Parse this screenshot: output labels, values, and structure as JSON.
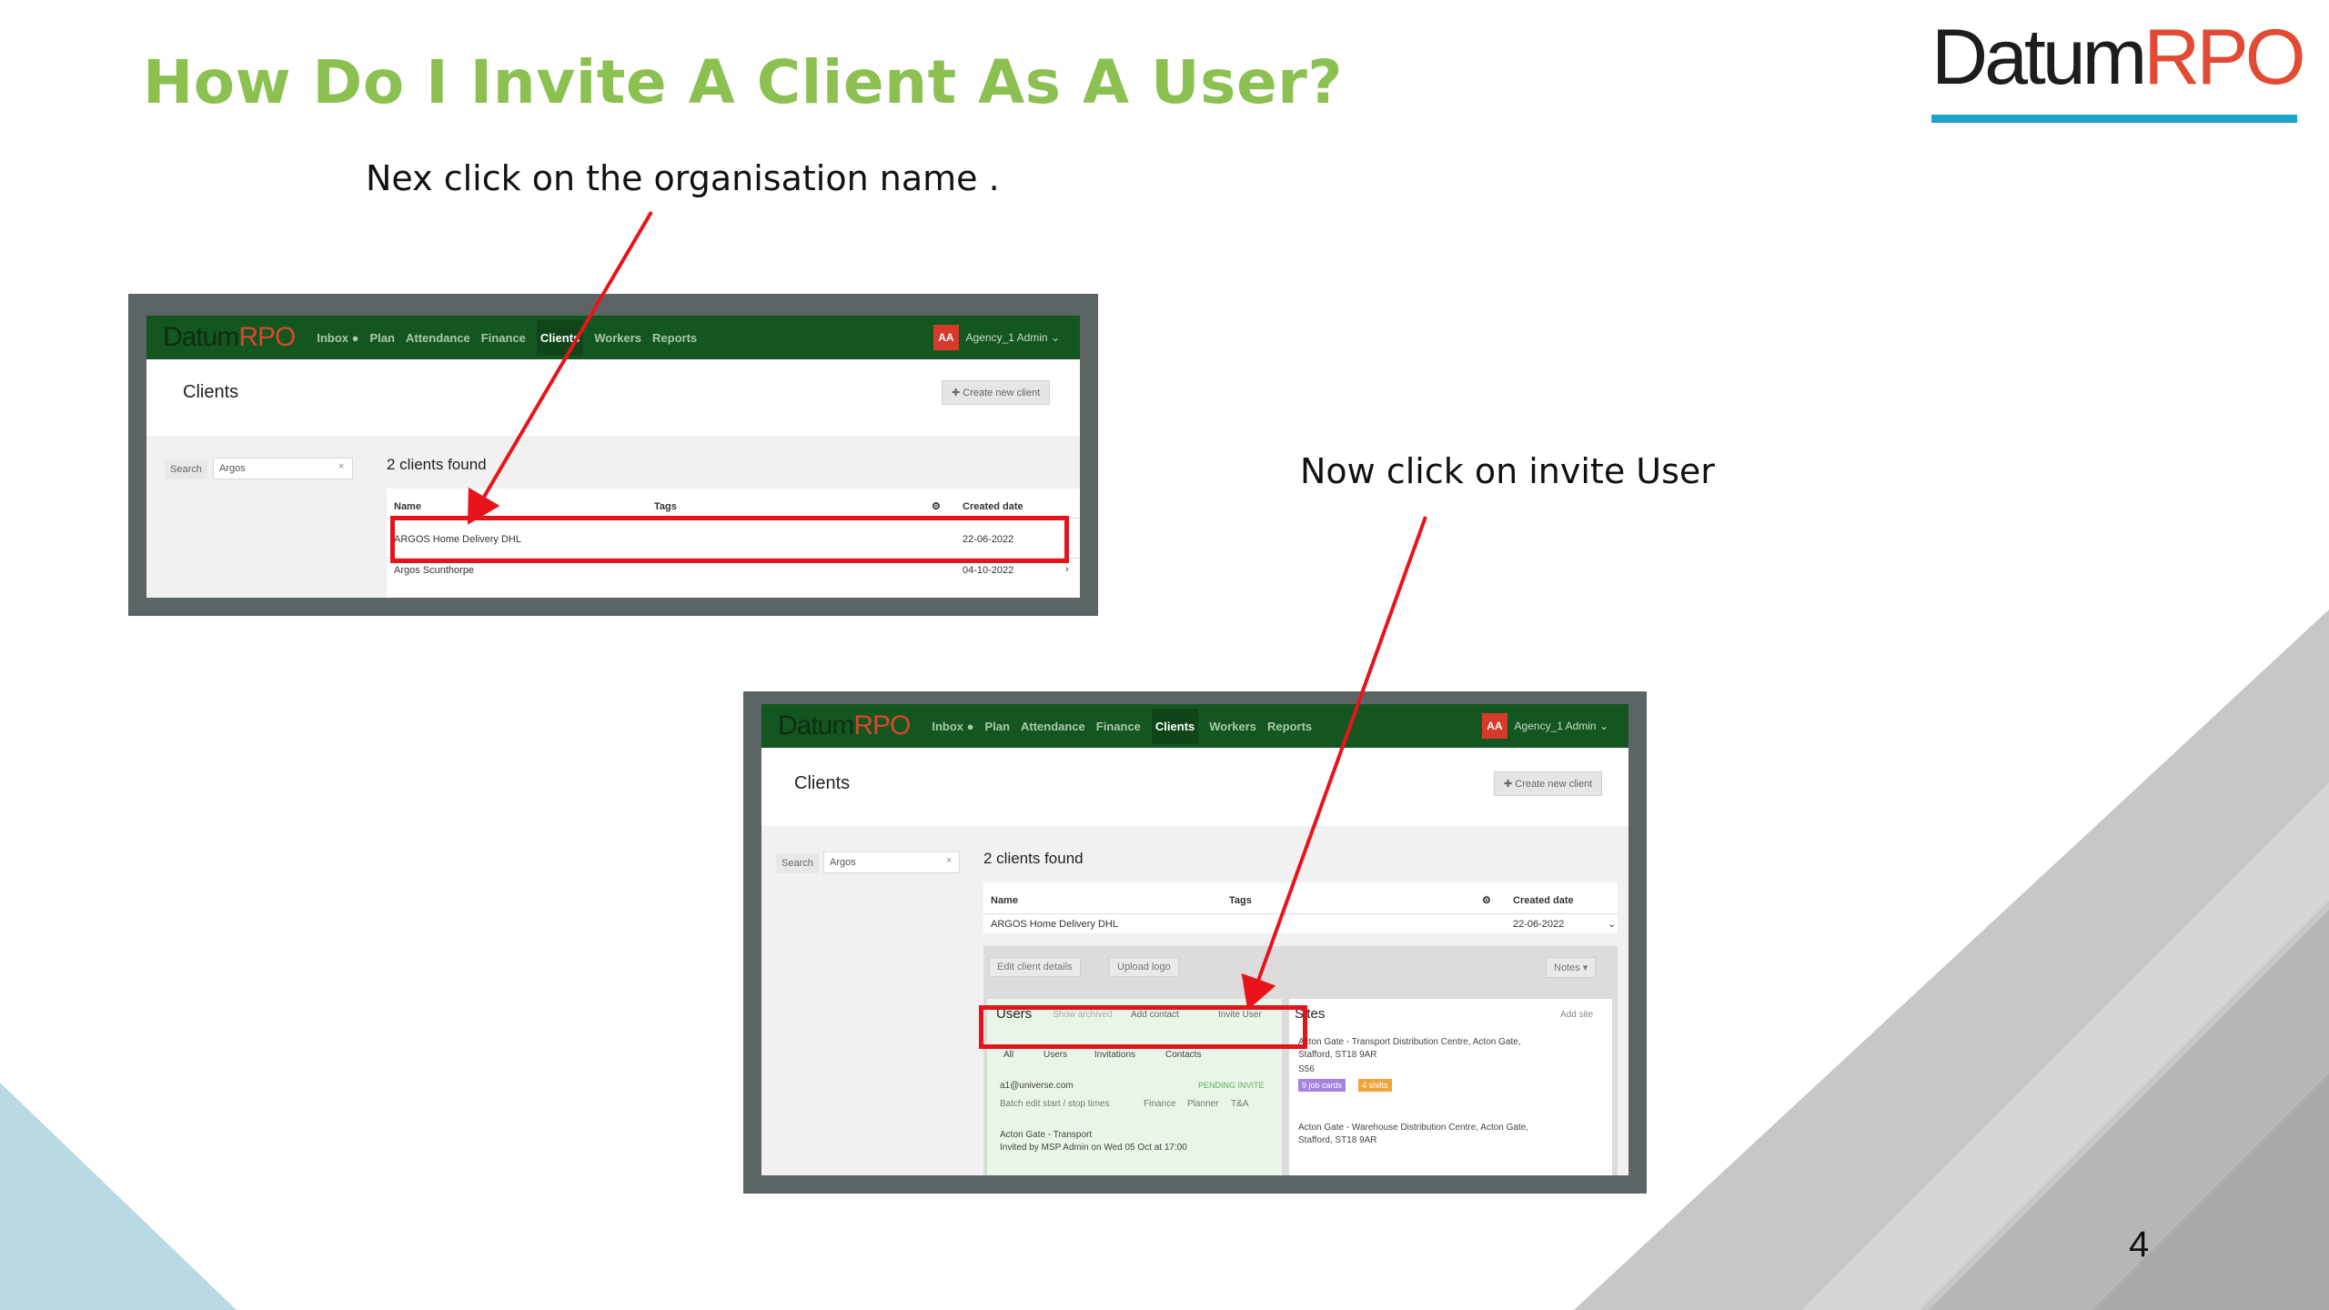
{
  "slide": {
    "title": "How Do I Invite A Client As A User?",
    "instruction_1": "Nex click on the organisation name .",
    "instruction_2": "Now click on invite User",
    "page_number": "4"
  },
  "logo": {
    "part1": "Datum",
    "part2": "RPO"
  },
  "colors": {
    "title_green": "#8cc152",
    "logo_blue": "#1aa3c7",
    "logo_red": "#e24a33",
    "nav_green": "#14561f",
    "highlight_red": "#e2151b",
    "arrow_red": "#e8141a"
  },
  "app": {
    "nav": {
      "logo_part1": "Datum",
      "logo_part2": "RPO",
      "items": [
        "Inbox ●",
        "Plan",
        "Attendance",
        "Finance",
        "Clients",
        "Workers",
        "Reports"
      ],
      "active_item": "Clients",
      "avatar_initials": "AA",
      "account_name": "Agency_1 Admin ⌄"
    },
    "page_heading": "Clients",
    "create_button": "✚ Create new client",
    "search_label": "Search",
    "search_value": "Argos",
    "search_clear": "×",
    "results_text": "2 clients found",
    "table_headers": {
      "name": "Name",
      "tags": "Tags",
      "gear": "⚙",
      "created": "Created date"
    },
    "rows": [
      {
        "name": "ARGOS Home Delivery DHL",
        "date": "22-06-2022",
        "chevron": "›"
      },
      {
        "name": "Argos Scunthorpe",
        "date": "04-10-2022",
        "chevron": "›"
      }
    ],
    "expanded_chevron": "⌄",
    "client_actions": {
      "edit": "Edit client details",
      "upload": "Upload logo",
      "notes": "Notes ▾"
    },
    "users_panel": {
      "title": "Users",
      "show_archived": "Show archived",
      "add_contact": "Add contact",
      "invite_user": "Invite User",
      "filters": [
        "All",
        "Users",
        "Invitations",
        "Contacts"
      ],
      "user_email": "a1@universe.com",
      "user_status": "PENDING INVITE",
      "user_tags": [
        "Batch edit start / stop times",
        "Finance",
        "Planner",
        "T&A"
      ],
      "user_site": "Acton Gate - Transport",
      "user_invited": "Invited by MSP Admin on Wed 05 Oct at 17:00"
    },
    "sites_panel": {
      "title": "Sites",
      "add_site": "Add site",
      "site1_line1": "Acton Gate - Transport Distribution Centre, Acton Gate,",
      "site1_line2": "Stafford, ST18 9AR",
      "site1_code": "S56",
      "site1_tags": [
        "9 job cards",
        "4 shifts"
      ],
      "site2_line1": "Acton Gate - Warehouse Distribution Centre, Acton Gate,",
      "site2_line2": "Stafford, ST18 9AR"
    }
  }
}
